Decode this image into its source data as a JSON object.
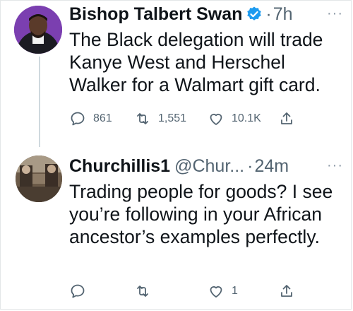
{
  "tweets": [
    {
      "name": "Bishop Talbert Swan",
      "verified": true,
      "handle": "",
      "time": "7h",
      "more": "···",
      "text": "The Black delegation will trade Kanye West and Herschel Walker for a Walmart gift card.",
      "replies": "861",
      "retweets": "1,551",
      "likes": "10.1K"
    },
    {
      "name": "Churchillis1",
      "verified": false,
      "handle": "@Chur...",
      "time": "24m",
      "more": "···",
      "text": "Trading people for goods? I see you’re following in your African ancestor’s examples perfectly.",
      "replies": "",
      "retweets": "",
      "likes": "1"
    }
  ],
  "icons": {
    "reply": "reply-icon",
    "retweet": "retweet-icon",
    "like": "heart-icon",
    "share": "share-icon",
    "verified": "verified-badge-icon",
    "more": "more-icon"
  },
  "colors": {
    "verified": "#1d9bf0",
    "text": "#0f1419",
    "muted": "#536471",
    "thread_line": "#cfd9de"
  }
}
